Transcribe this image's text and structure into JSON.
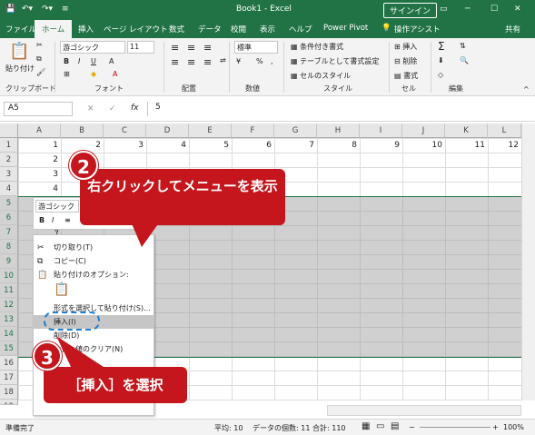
{
  "titlebar": {
    "title": "Book1 - Excel",
    "signin": "サインイン"
  },
  "tabs": [
    {
      "label": "ファイル"
    },
    {
      "label": "ホーム"
    },
    {
      "label": "挿入"
    },
    {
      "label": "ページ レイアウト"
    },
    {
      "label": "数式"
    },
    {
      "label": "データ"
    },
    {
      "label": "校閲"
    },
    {
      "label": "表示"
    },
    {
      "label": "ヘルプ"
    },
    {
      "label": "Power Pivot"
    },
    {
      "label": "操作アシスト"
    },
    {
      "label": "共有"
    }
  ],
  "ribbon": {
    "paste": "貼り付け",
    "clipboard": "クリップボード",
    "font_name": "游ゴシック",
    "font_size": "11",
    "font": "フォント",
    "alignment": "配置",
    "number_format": "標準",
    "number": "数値",
    "cond_format": "条件付き書式",
    "table_format": "テーブルとして書式設定",
    "cell_style": "セルのスタイル",
    "style": "スタイル",
    "insert": "挿入",
    "delete": "削除",
    "format": "書式",
    "cells": "セル",
    "edit": "編集"
  },
  "formula_bar": {
    "name_box": "A5",
    "value": "5",
    "fx": "fx"
  },
  "columns": [
    "A",
    "B",
    "C",
    "D",
    "E",
    "F",
    "G",
    "H",
    "I",
    "J",
    "K",
    "L"
  ],
  "rows": [
    "1",
    "2",
    "3",
    "4",
    "5",
    "6",
    "7",
    "8",
    "9",
    "10",
    "11",
    "12",
    "13",
    "14",
    "15",
    "16",
    "17",
    "18",
    "19"
  ],
  "row1_values": [
    "1",
    "2",
    "3",
    "4",
    "5",
    "6",
    "7",
    "8",
    "9",
    "10",
    "11",
    "12"
  ],
  "colA_values": [
    "2",
    "3",
    "4"
  ],
  "row7_value": "7",
  "minibar": {
    "font": "游ゴシック"
  },
  "context_menu": [
    "切り取り(T)",
    "コピー(C)",
    "貼り付けのオプション:",
    "形式を選択して貼り付け(S)...",
    "挿入(I)",
    "削除(D)",
    "数式と値のクリア(N)"
  ],
  "callout2": {
    "num": "2",
    "text": "右クリックしてメニューを表示"
  },
  "callout3": {
    "num": "3",
    "text": "［挿入］を選択"
  },
  "status": {
    "ready": "準備完了",
    "average": "平均: 10",
    "count": "データの個数: 11",
    "sum": "合計: 110",
    "zoom": "100%"
  }
}
